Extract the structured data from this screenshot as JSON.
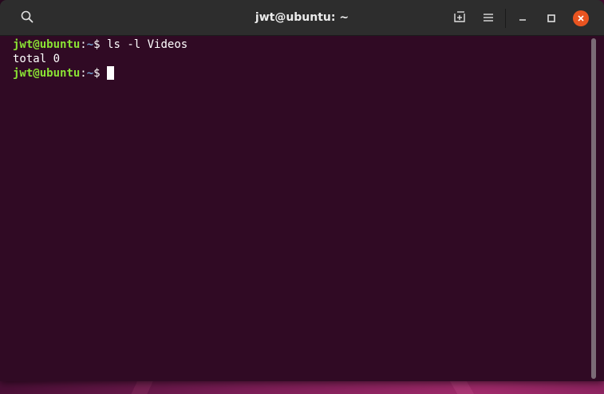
{
  "window": {
    "title": "jwt@ubuntu: ~"
  },
  "headerbar": {
    "search_icon": "search-icon",
    "new_tab_icon": "new-tab-icon",
    "menu_icon": "hamburger-menu-icon",
    "minimize_icon": "minimize-icon",
    "maximize_icon": "maximize-icon",
    "close_icon": "close-icon"
  },
  "terminal": {
    "lines": [
      {
        "user": "jwt@ubuntu",
        "sep": ":",
        "path": "~",
        "prompt": "$ ",
        "command": "ls -l Videos"
      },
      {
        "output": "total 0"
      },
      {
        "user": "jwt@ubuntu",
        "sep": ":",
        "path": "~",
        "prompt": "$ ",
        "command": ""
      }
    ]
  },
  "colors": {
    "terminal_bg": "#300a24",
    "prompt_user": "#8ae234",
    "prompt_path": "#729fcf",
    "close_button": "#e95420",
    "headerbar": "#2d2d2d"
  }
}
